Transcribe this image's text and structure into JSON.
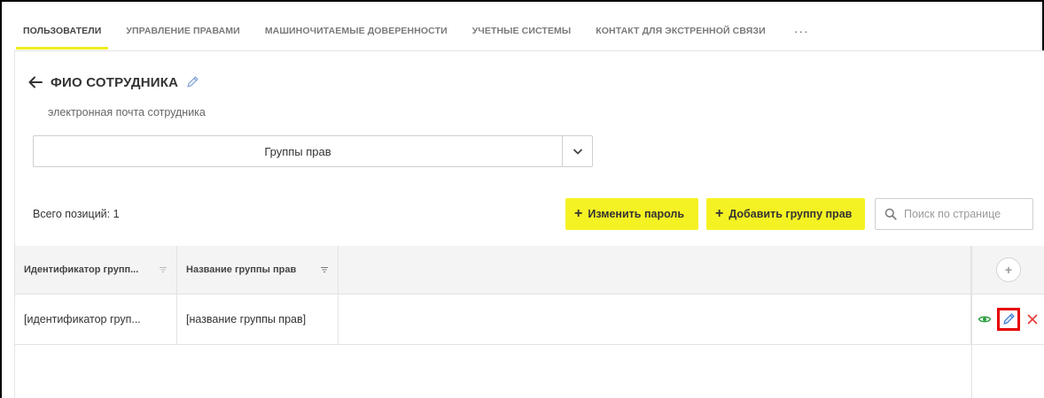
{
  "tabs": [
    {
      "label": "ПОЛЬЗОВАТЕЛИ",
      "active": true
    },
    {
      "label": "УПРАВЛЕНИЕ ПРАВАМИ",
      "active": false
    },
    {
      "label": "МАШИНОЧИТАЕМЫЕ ДОВЕРЕННОСТИ",
      "active": false
    },
    {
      "label": "УЧЕТНЫЕ СИСТЕМЫ",
      "active": false
    },
    {
      "label": "КОНТАКТ ДЛЯ ЭКСТРЕННОЙ СВЯЗИ",
      "active": false
    }
  ],
  "tabs_more": "···",
  "header": {
    "title": "ФИО СОТРУДНИКА",
    "subtitle": "электронная почта сотрудника"
  },
  "group_select": {
    "value": "Группы прав"
  },
  "toolbar": {
    "total_label": "Всего позиций: 1",
    "change_password_label": "Изменить пароль",
    "add_group_label": "Добавить группу прав",
    "plus": "+",
    "search_placeholder": "Поиск по странице"
  },
  "table": {
    "columns": [
      "Идентификатор групп...",
      "Название группы прав"
    ],
    "rows": [
      [
        "[идентификатор груп...",
        "[название группы прав]"
      ]
    ],
    "add_column": "+"
  },
  "colors": {
    "accent": "#f5f224",
    "highlight": "#e60000",
    "view_icon": "#2e9e3f",
    "edit_icon": "#3a7bd5",
    "delete_icon": "#e53935"
  },
  "icons": [
    "back-arrow-icon",
    "pencil-icon",
    "chevron-down-icon",
    "search-icon",
    "sort-icon",
    "plus-icon",
    "eye-icon",
    "close-icon"
  ]
}
